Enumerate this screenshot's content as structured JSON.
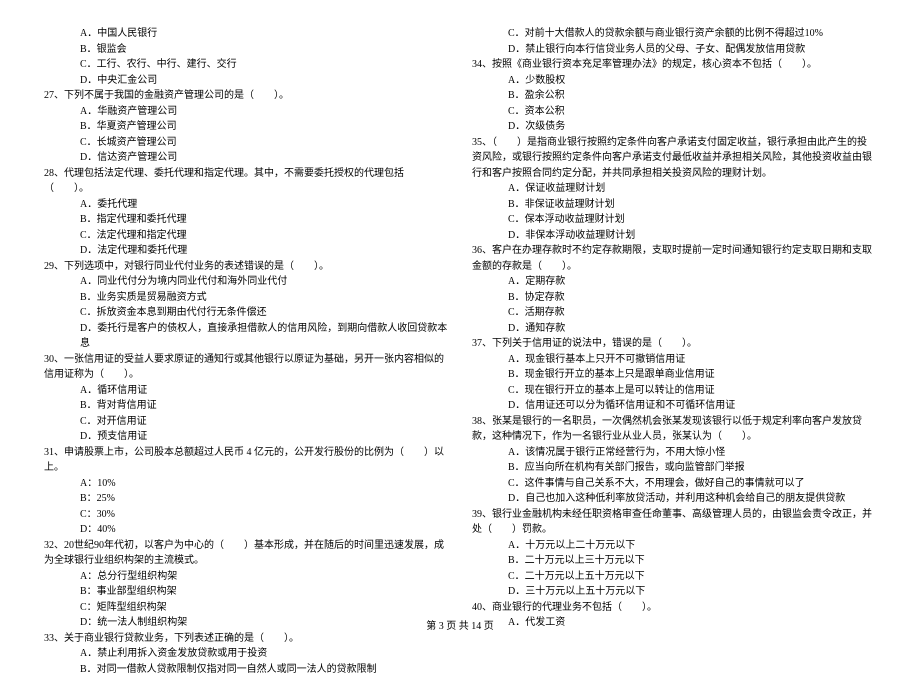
{
  "left": {
    "o26a": "A．中国人民银行",
    "o26b": "B．银监会",
    "o26c": "C．工行、农行、中行、建行、交行",
    "o26d": "D．中央汇金公司",
    "q27": "27、下列不属于我国的金融资产管理公司的是（　　）。",
    "o27a": "A．华融资产管理公司",
    "o27b": "B．华夏资产管理公司",
    "o27c": "C．长城资产管理公司",
    "o27d": "D．信达资产管理公司",
    "q28": "28、代理包括法定代理、委托代理和指定代理。其中，不需要委托授权的代理包括（　　）。",
    "o28a": "A．委托代理",
    "o28b": "B．指定代理和委托代理",
    "o28c": "C．法定代理和指定代理",
    "o28d": "D．法定代理和委托代理",
    "q29": "29、下列选项中，对银行同业代付业务的表述错误的是（　　）。",
    "o29a": "A．同业代付分为境内同业代付和海外同业代付",
    "o29b": "B．业务实质是贸易融资方式",
    "o29c": "C．拆放资金本息到期由代付行无条件偿还",
    "o29d": "D．委托行是客户的债权人，直接承担借款人的信用风险，到期向借款人收回贷款本息",
    "q30": "30、一张信用证的受益人要求原证的通知行或其他银行以原证为基础，另开一张内容相似的信用证称为（　　）。",
    "o30a": "A．循环信用证",
    "o30b": "B．背对背信用证",
    "o30c": "C．对开信用证",
    "o30d": "D．预支信用证",
    "q31": "31、申请股票上市，公司股本总额超过人民币 4 亿元的，公开发行股份的比例为（　　）以上。",
    "o31a": "A：10%",
    "o31b": "B：25%",
    "o31c": "C：30%",
    "o31d": "D：40%",
    "q32": "32、20世纪90年代初，以客户为中心的（　　）基本形成，并在随后的时间里迅速发展，成为全球银行业组织构架的主流模式。",
    "o32a": "A：总分行型组织构架",
    "o32b": "B：事业部型组织构架",
    "o32c": "C：矩阵型组织构架",
    "o32d": "D：统一法人制组织构架",
    "q33": "33、关于商业银行贷款业务，下列表述正确的是（　　）。",
    "o33a": "A．禁止利用拆入资金发放贷款或用于投资",
    "o33b": "B．对同一借款人贷款限制仅指对同一自然人或同一法人的贷款限制"
  },
  "right": {
    "o33c": "C．对前十大借款人的贷款余额与商业银行资产余额的比例不得超过10%",
    "o33d": "D．禁止银行向本行信贷业务人员的父母、子女、配偶发放信用贷款",
    "q34": "34、按照《商业银行资本充足率管理办法》的规定，核心资本不包括（　　）。",
    "o34a": "A．少数股权",
    "o34b": "B．盈余公积",
    "o34c": "C．资本公积",
    "o34d": "D．次级债务",
    "q35": "35、（　　）是指商业银行按照约定条件向客户承诺支付固定收益，银行承担由此产生的投资风险，或银行按照约定条件向客户承诺支付最低收益并承担相关风险，其他投资收益由银行和客户按照合同约定分配，并共同承担相关投资风险的理财计划。",
    "o35a": "A．保证收益理财计划",
    "o35b": "B．非保证收益理财计划",
    "o35c": "C．保本浮动收益理财计划",
    "o35d": "D．非保本浮动收益理财计划",
    "q36": "36、客户在办理存款时不约定存款期限，支取时提前一定时间通知银行约定支取日期和支取金额的存款是（　　）。",
    "o36a": "A．定期存款",
    "o36b": "B．协定存款",
    "o36c": "C．活期存款",
    "o36d": "D．通知存款",
    "q37": "37、下列关于信用证的说法中，错误的是（　　）。",
    "o37a": "A．现金银行基本上只开不可撤销信用证",
    "o37b": "B．现金银行开立的基本上只是跟单商业信用证",
    "o37c": "C．现在银行开立的基本上是可以转让的信用证",
    "o37d": "D．信用证还可以分为循环信用证和不可循环信用证",
    "q38": "38、张某是银行的一名职员，一次偶然机会张某发现该银行以低于规定利率向客户发放贷款，这种情况下，作为一名银行业从业人员，张某认为（　　）。",
    "o38a": "A．该情况属于银行正常经营行为，不用大惊小怪",
    "o38b": "B．应当向所在机构有关部门报告，或向监管部门举报",
    "o38c": "C．这件事情与自己关系不大，不用理会，做好自己的事情就可以了",
    "o38d": "D．自己也加入这种低利率放贷活动，并利用这种机会给自己的朋友提供贷款",
    "q39": "39、银行业金融机构未经任职资格审查任命董事、高级管理人员的，由银监会责令改正，并处（　　）罚款。",
    "o39a": "A．十万元以上二十万元以下",
    "o39b": "B．二十万元以上三十万元以下",
    "o39c": "C．二十万元以上五十万元以下",
    "o39d": "D．三十万元以上五十万元以下",
    "q40": "40、商业银行的代理业务不包括（　　）。",
    "o40a": "A．代发工资"
  },
  "footer": "第 3 页 共 14 页"
}
